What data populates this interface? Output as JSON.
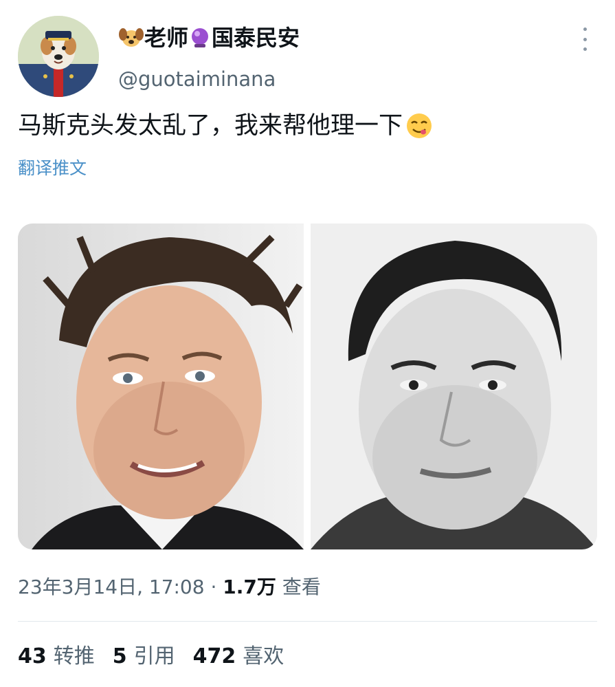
{
  "author": {
    "display_name_prefix_emoji": "dog-face-emoji",
    "display_name_part1": "老师",
    "display_name_mid_emoji": "crystal-ball-emoji",
    "display_name_part2": "国泰民安",
    "handle": "@guotaiminana"
  },
  "tweet": {
    "text": "马斯克头发太乱了，我来帮他理一下",
    "trailing_emoji": "yum-face-emoji",
    "translate_label": "翻译推文"
  },
  "media": {
    "left_photo": "portrait-photo",
    "right_photo": "black-and-white-portrait-photo"
  },
  "meta": {
    "date_time": "23年3月14日, 17:08",
    "separator": "·",
    "views_count": "1.7万",
    "views_label": "查看"
  },
  "stats": {
    "retweets_count": "43",
    "retweets_label": "转推",
    "quotes_count": "5",
    "quotes_label": "引用",
    "likes_count": "472",
    "likes_label": "喜欢"
  },
  "colors": {
    "secondary_text": "#536471",
    "link": "#4a90c8",
    "divider": "#e1e8ed"
  }
}
